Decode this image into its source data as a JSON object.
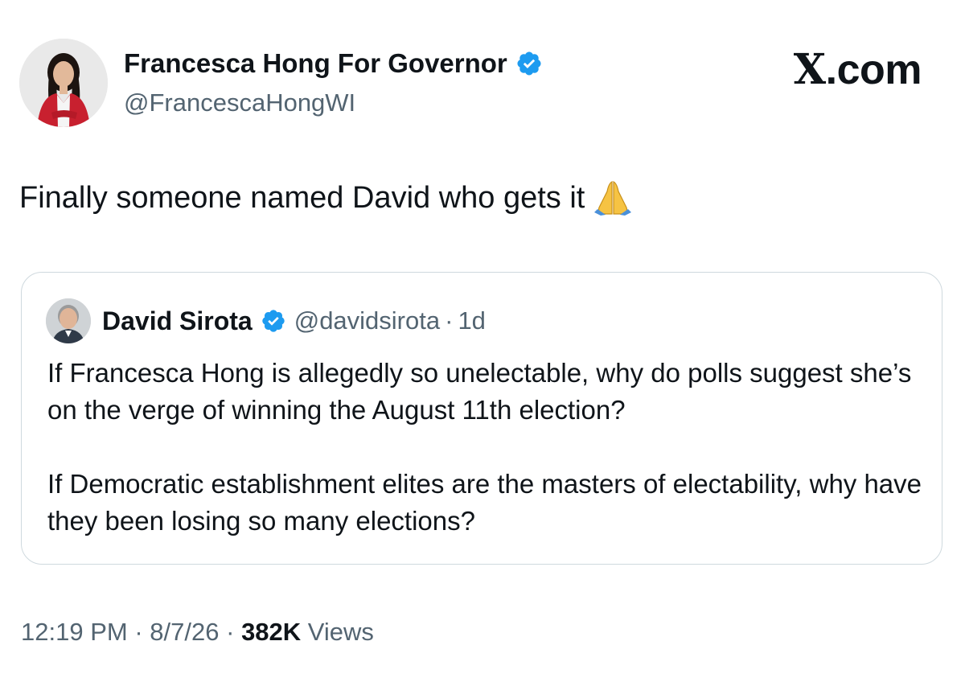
{
  "author": {
    "name": "Francesca Hong For Governor",
    "handle": "@FrancescaHongWI",
    "verified": true
  },
  "brand": {
    "x_letter": "X",
    "suffix": ".com"
  },
  "tweet": {
    "text": "Finally someone named David who gets it",
    "emoji_icon": "folded-hands-icon"
  },
  "quoted": {
    "name": "David Sirota",
    "handle": "@davidsirota",
    "separator": "·",
    "time": "1d",
    "verified": true,
    "paragraphs": [
      "If Francesca Hong is allegedly so unelectable, why do polls suggest she’s on the verge of winning the August 11th election?",
      "If Democratic establishment elites are the masters of electability, why have they been losing so many elections?"
    ]
  },
  "meta": {
    "time": "12:19 PM",
    "sep1": "·",
    "date": "8/7/26",
    "sep2": "·",
    "views_count": "382K",
    "views_label": "Views"
  },
  "colors": {
    "text": "#0f1419",
    "secondary": "#536471",
    "verified_blue": "#1d9bf0",
    "card_border": "#cfd9de"
  }
}
